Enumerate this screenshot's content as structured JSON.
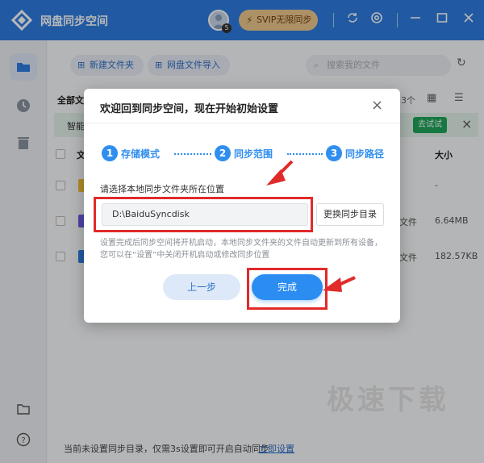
{
  "app": {
    "title": "网盘同步空间",
    "avatar_badge": "5",
    "svip_label": "SVIP无限同步"
  },
  "toolbar": {
    "new_folder": "新建文件夹",
    "import": "网盘文件导入",
    "search_placeholder": "搜索我的文件"
  },
  "list": {
    "breadcrumb": "全部文",
    "count": "3个",
    "notice_prefix": "智能",
    "notice_button": "去试试",
    "columns": {
      "name": "文",
      "size": "大小"
    },
    "rows": [
      {
        "type": "",
        "size": "-"
      },
      {
        "type": "文件",
        "size": "6.64MB"
      },
      {
        "type": "文件",
        "size": "182.57KB"
      }
    ]
  },
  "status": {
    "text": "当前未设置同步目录，仅需3s设置即可开启自动同步",
    "link": "立即设置"
  },
  "watermark": "极速下载",
  "dialog": {
    "title": "欢迎回到同步空间，现在开始初始设置",
    "steps": [
      {
        "num": "1",
        "label": "存储模式"
      },
      {
        "num": "2",
        "label": "同步范围"
      },
      {
        "num": "3",
        "label": "同步路径"
      }
    ],
    "prompt": "请选择本地同步文件夹所在位置",
    "path_value": "D:\\BaiduSyncdisk",
    "change_button": "更换同步目录",
    "info": "设置完成后同步空间将开机启动，本地同步文件夹的文件自动更新到所有设备，您可以在“设置”中关闭开机启动或修改同步位置",
    "prev_button": "上一步",
    "done_button": "完成"
  },
  "colors": {
    "titlebar": "#2f7de1",
    "accent": "#2b8cf2",
    "annotation_red": "#e12a2a",
    "svip": "#f0c98e"
  }
}
